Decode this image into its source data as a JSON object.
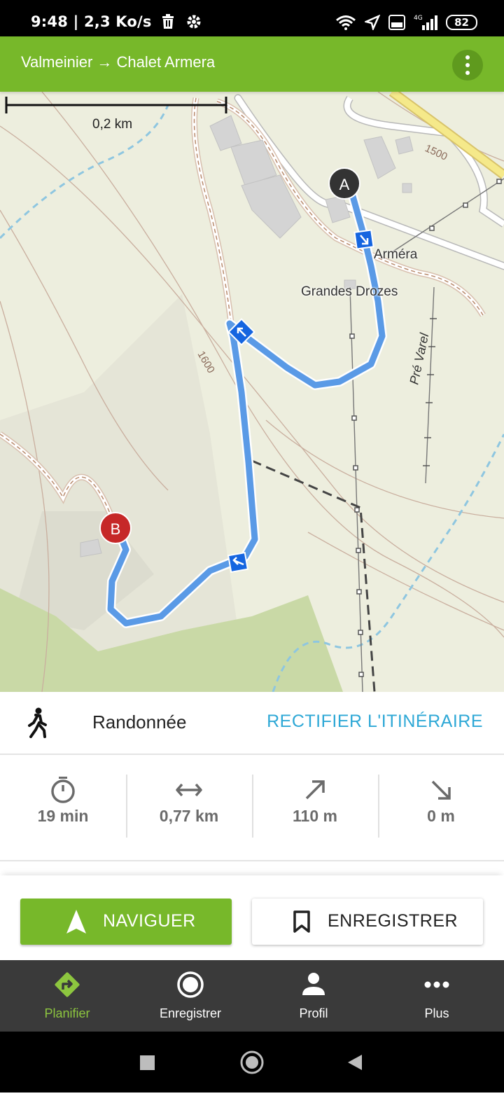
{
  "status_bar": {
    "time": "9:48",
    "network_speed": "2,3 Ko/s",
    "battery": "82",
    "signal": "4G"
  },
  "app_bar": {
    "title": "Valmeinier → Chalet Armera"
  },
  "map": {
    "scale_label": "0,2 km",
    "labels": {
      "armera": "Arméra",
      "grandes_drozes": "Grandes Drozes",
      "pre_varel": "Pré Varel",
      "contour_1500": "1500",
      "contour_1600": "1600"
    },
    "start_marker": "A",
    "end_marker": "B"
  },
  "route": {
    "activity": "Randonnée",
    "rectify_label": "RECTIFIER L'ITINÉRAIRE",
    "stats": {
      "duration": "19 min",
      "distance": "0,77 km",
      "ascent": "110 m",
      "descent": "0 m"
    }
  },
  "actions": {
    "navigate_label": "NAVIGUER",
    "save_label": "ENREGISTRER"
  },
  "bottom_nav": {
    "items": [
      {
        "label": "Planifier",
        "icon": "directions-icon",
        "active": true
      },
      {
        "label": "Enregistrer",
        "icon": "record-icon",
        "active": false
      },
      {
        "label": "Profil",
        "icon": "person-icon",
        "active": false
      },
      {
        "label": "Plus",
        "icon": "more-icon",
        "active": false
      }
    ]
  },
  "colors": {
    "brand_green": "#77b82a",
    "route_blue": "#4a90e2",
    "link_blue": "#2ea8d6",
    "start_marker": "#333333",
    "end_marker": "#c62828"
  }
}
